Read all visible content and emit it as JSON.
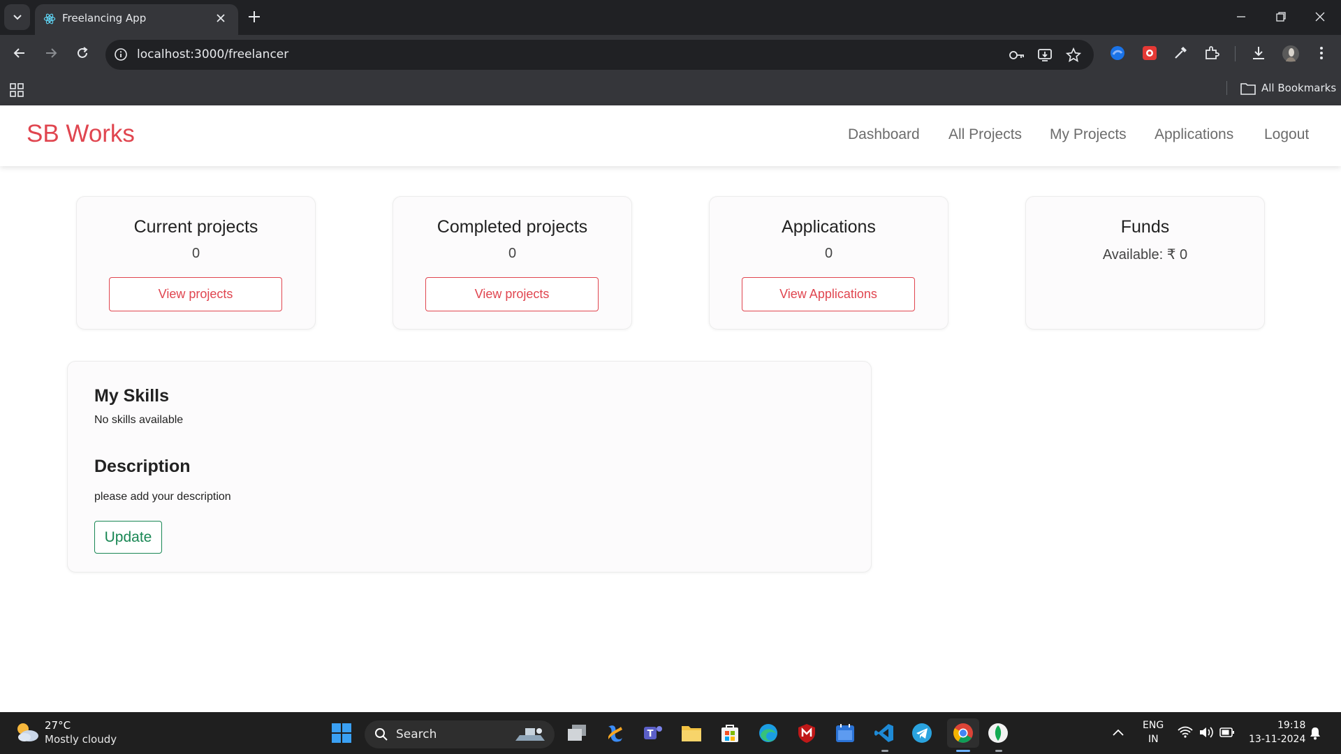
{
  "browser": {
    "tab_title": "Freelancing App",
    "url": "localhost:3000/freelancer",
    "bookmarks_label": "All Bookmarks"
  },
  "app": {
    "brand": "SB Works",
    "nav": [
      "Dashboard",
      "All Projects",
      "My Projects",
      "Applications",
      "Logout"
    ],
    "cards": [
      {
        "title": "Current projects",
        "value": "0",
        "button": "View projects"
      },
      {
        "title": "Completed projects",
        "value": "0",
        "button": "View projects"
      },
      {
        "title": "Applications",
        "value": "0",
        "button": "View Applications"
      },
      {
        "title": "Funds",
        "value": "Available: ₹ 0"
      }
    ],
    "skills": {
      "heading": "My Skills",
      "text": "No skills available",
      "description_heading": "Description",
      "description_text": "please add your description",
      "update_button": "Update"
    },
    "colors": {
      "brand": "#e0454f",
      "update": "#198754"
    }
  },
  "taskbar": {
    "weather_temp": "27°C",
    "weather_desc": "Mostly cloudy",
    "search_placeholder": "Search",
    "lang_line1": "ENG",
    "lang_line2": "IN",
    "time": "19:18",
    "date": "13-11-2024"
  }
}
